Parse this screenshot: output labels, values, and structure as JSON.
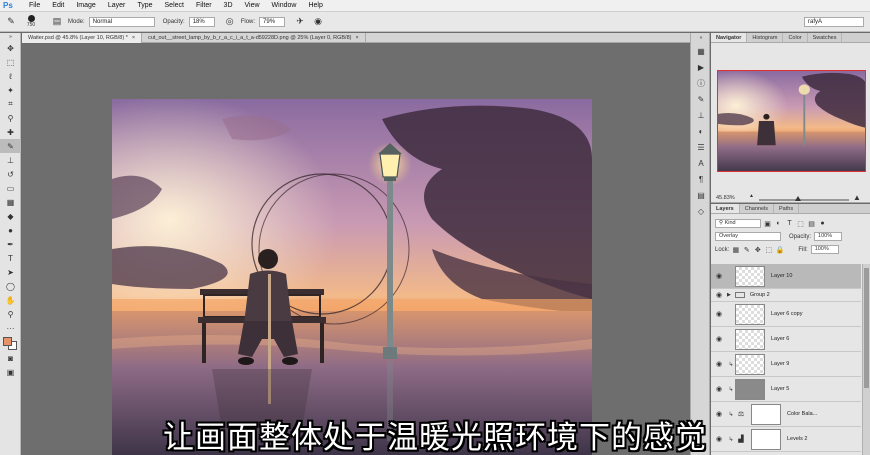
{
  "menubar": {
    "logo": "Ps",
    "items": [
      "File",
      "Edit",
      "Image",
      "Layer",
      "Type",
      "Select",
      "Filter",
      "3D",
      "View",
      "Window",
      "Help"
    ]
  },
  "options": {
    "brush_size": "750",
    "mode_label": "Mode:",
    "mode_value": "Normal",
    "opacity_label": "Opacity:",
    "opacity_value": "18%",
    "flow_label": "Flow:",
    "flow_value": "79%",
    "workspace_value": "rafyA"
  },
  "doc_tabs": [
    {
      "label": "Waiter.psd @ 45.8% (Layer 10, RGB/8) *"
    },
    {
      "label": "cut_out__street_lamp_by_b_r_a_c_i_a_t_a-d59228D.png @ 25% (Layer 0, RGB/8)"
    }
  ],
  "navigator": {
    "tabs": [
      "Navigator",
      "Histogram",
      "Color",
      "Swatches"
    ],
    "zoom": "45.83%"
  },
  "layers_panel": {
    "tabs": [
      "Layers",
      "Channels",
      "Paths"
    ],
    "filter_kind": "Kind",
    "blend_mode": "Overlay",
    "opacity_label": "Opacity:",
    "opacity_value": "100%",
    "lock_label": "Lock:",
    "fill_label": "Fill:",
    "fill_value": "100%",
    "layers": [
      {
        "name": "Layer 10"
      },
      {
        "name": "Group 2"
      },
      {
        "name": "Layer 6 copy"
      },
      {
        "name": "Layer 6"
      },
      {
        "name": "Layer 9"
      },
      {
        "name": "Layer 5"
      },
      {
        "name": "Color Bala..."
      },
      {
        "name": "Levels 2"
      }
    ]
  },
  "subtitle": "让画面整体处于温暖光照环境下的感觉",
  "colors": {
    "foreground": "#e8926a",
    "background": "#ffffff",
    "navigator_frame": "#e03030"
  }
}
